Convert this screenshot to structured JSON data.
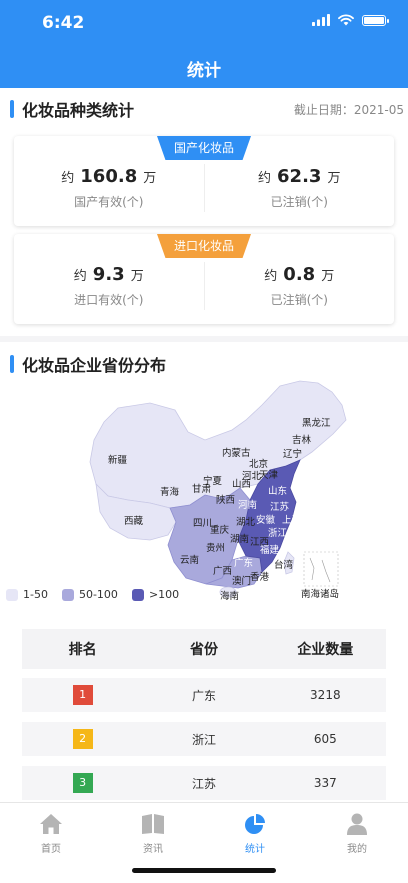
{
  "status_bar": {
    "time": "6:42"
  },
  "nav": {
    "title": "统计"
  },
  "section_species": {
    "title": "化妆品种类统计",
    "date": "截止日期：2021-05"
  },
  "domestic": {
    "tag": "国产化妆品",
    "left": {
      "prefix": "约",
      "value": "160.8",
      "unit": "万",
      "label": "国产有效(个)"
    },
    "right": {
      "prefix": "约",
      "value": "62.3",
      "unit": "万",
      "label": "已注销(个)"
    }
  },
  "imported": {
    "tag": "进口化妆品",
    "left": {
      "prefix": "约",
      "value": "9.3",
      "unit": "万",
      "label": "进口有效(个)"
    },
    "right": {
      "prefix": "约",
      "value": "0.8",
      "unit": "万",
      "label": "已注销(个)"
    }
  },
  "section_map": {
    "title": "化妆品企业省份分布"
  },
  "map_labels": {
    "xinjiang": "新疆",
    "xizang": "西藏",
    "qinghai": "青海",
    "gansu": "甘肃",
    "neimenggu": "内蒙古",
    "ningxia": "宁夏",
    "shaanxi": "陕西",
    "shanxi": "山西",
    "hebei": "河北",
    "beijing": "北京",
    "tianjin": "天津",
    "liaoning": "辽宁",
    "jilin": "吉林",
    "heilongjiang": "黑龙江",
    "sichuan": "四川",
    "chongqing": "重庆",
    "yunnan": "云南",
    "guizhou": "贵州",
    "hubei": "湖北",
    "hunan": "湖南",
    "anhui": "安徽",
    "jiangxi": "江西",
    "guangxi": "广西",
    "guangdong": "广东",
    "fujian": "福建",
    "taiwan": "台湾",
    "hainan": "海南",
    "hongkong": "香港",
    "macao": "澳门",
    "shandong": "山东",
    "henan": "河南",
    "jiangsu": "江苏",
    "shanghai": "上海",
    "zhejiang": "浙江",
    "south_sea": "南海诸岛"
  },
  "legend": [
    {
      "label": "1-50",
      "color": "#e6e6f6"
    },
    {
      "label": "50-100",
      "color": "#a9a9dc"
    },
    {
      "label": ">100",
      "color": "#5a5ab4"
    }
  ],
  "table": {
    "headers": [
      "排名",
      "省份",
      "企业数量"
    ],
    "rows": [
      {
        "rank": "1",
        "province": "广东",
        "count": "3218",
        "color": "#e04b3a"
      },
      {
        "rank": "2",
        "province": "浙江",
        "count": "605",
        "color": "#f5b718"
      },
      {
        "rank": "3",
        "province": "江苏",
        "count": "337",
        "color": "#34a853"
      }
    ]
  },
  "tabbar": {
    "items": [
      {
        "label": "首页",
        "icon": "home-icon"
      },
      {
        "label": "资讯",
        "icon": "book-icon"
      },
      {
        "label": "统计",
        "icon": "pie-chart-icon"
      },
      {
        "label": "我的",
        "icon": "user-icon"
      }
    ],
    "active_color": "#2f8ff4"
  }
}
